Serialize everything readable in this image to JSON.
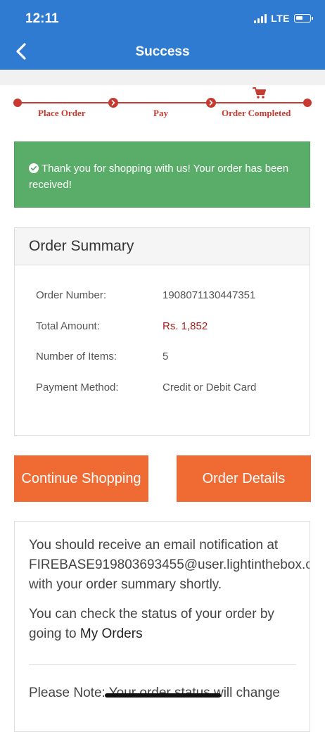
{
  "status_bar": {
    "time": "12:11",
    "network": "LTE"
  },
  "header": {
    "title": "Success"
  },
  "progress": {
    "steps": [
      "Place Order",
      "Pay",
      "Order Completed"
    ],
    "current_step": 3
  },
  "success_message": "Thank you for shopping with us! Your order has been received!",
  "order_summary": {
    "title": "Order Summary",
    "rows": [
      {
        "label": "Order Number:",
        "value": "1908071130447351"
      },
      {
        "label": "Total Amount:",
        "value": "Rs. 1,852"
      },
      {
        "label": "Number of Items:",
        "value": "5"
      },
      {
        "label": "Payment Method:",
        "value": "Credit or Debit Card"
      }
    ]
  },
  "buttons": {
    "continue_shopping": "Continue Shopping",
    "order_details": "Order Details"
  },
  "info": {
    "email_line1": "You should receive an email notification at",
    "email_address": "FIREBASE919803693455@user.lightinthebox.c",
    "email_line3": "with your order summary shortly.",
    "status_line1": "You can check the status of your order by",
    "status_line2_prefix": "going to ",
    "my_orders_link": "My Orders",
    "note": "Please Note: Your order status will change"
  },
  "colors": {
    "header_blue": "#2f7bd1",
    "accent_red": "#c83a30",
    "success_green": "#5aac69",
    "button_orange": "#f06a33"
  },
  "icons": {
    "back": "chevron-left-icon",
    "cart": "cart-icon",
    "check": "check-circle-icon"
  }
}
